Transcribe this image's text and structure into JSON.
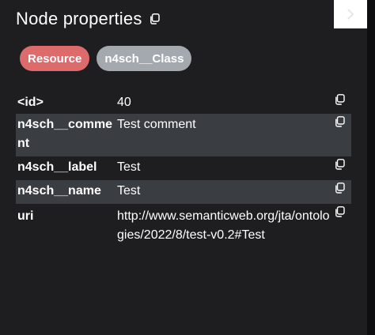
{
  "panel": {
    "title": "Node properties",
    "icons": {
      "title_copy": "copy-icon",
      "collapse": "chevron-right-icon"
    }
  },
  "labels": [
    {
      "text": "Resource",
      "color": "#dd6b6c"
    },
    {
      "text": "n4sch__Class",
      "color": "#a4a9b0"
    }
  ],
  "properties": [
    {
      "key": "<id>",
      "value": "40"
    },
    {
      "key": "n4sch__comment",
      "value": "Test comment"
    },
    {
      "key": "n4sch__label",
      "value": "Test"
    },
    {
      "key": "n4sch__name",
      "value": "Test"
    },
    {
      "key": "uri",
      "value": "http://www.semanticweb.org/jta/ontologies/2022/8/test-v0.2#Test"
    }
  ]
}
